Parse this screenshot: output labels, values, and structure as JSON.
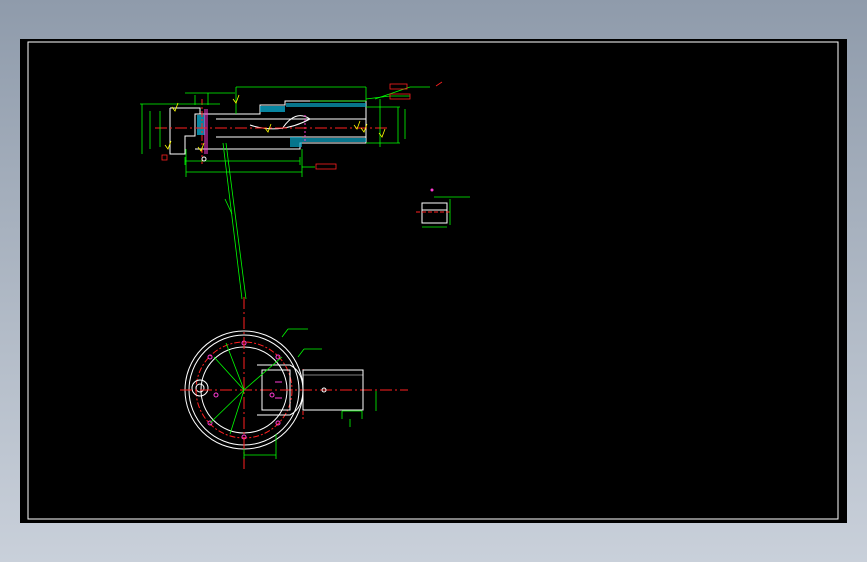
{
  "colors": {
    "background": "#000000",
    "frame": "#ffffff",
    "dimension": "#00ff00",
    "centerline": "#ff0000",
    "hatch": "#00bfff",
    "annotation": "#ffff00",
    "callout": "#ff0000",
    "hidden": "#ff00ff"
  },
  "annotations": {
    "callout_tag_1": "",
    "callout_tag_2": "",
    "callout_tag_3": ""
  }
}
